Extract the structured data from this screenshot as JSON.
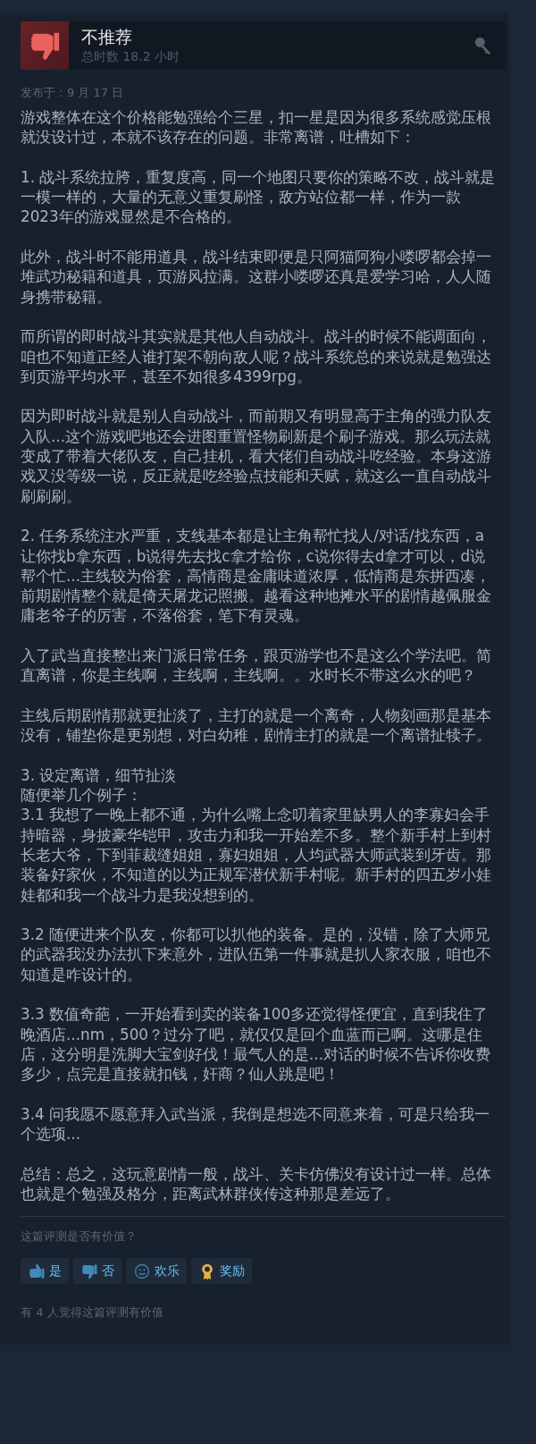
{
  "review": {
    "recommended": false,
    "verdict": "不推荐",
    "hours": "总时数 18.2 小时",
    "posted": "发布于：9 月 17 日"
  },
  "paragraphs": [
    [
      "游戏整体在这个价格能勉强给个三星，扣一星是因为很多系统感觉压根就没设计过，本就不该存在的问题。非常离谱，吐槽如下："
    ],
    [
      "1. 战斗系统拉胯，重复度高，同一个地图只要你的策略不改，战斗就是一模一样的，大量的无意义重复刷怪，敌方站位都一样，作为一款2023年的游戏显然是不合格的。"
    ],
    [
      "此外，战斗时不能用道具，战斗结束即便是只阿猫阿狗小喽啰都会掉一堆武功秘籍和道具，页游风拉满。这群小喽啰还真是爱学习哈，人人随身携带秘籍。"
    ],
    [
      "而所谓的即时战斗其实就是其他人自动战斗。战斗的时候不能调面向，咱也不知道正经人谁打架不朝向敌人呢？战斗系统总的来说就是勉强达到页游平均水平，甚至不如很多4399rpg。"
    ],
    [
      "因为即时战斗就是别人自动战斗，而前期又有明显高于主角的强力队友入队...这个游戏吧地还会进图重置怪物刷新是个刷子游戏。那么玩法就变成了带着大佬队友，自己挂机，看大佬们自动战斗吃经验。本身这游戏又没等级一说，反正就是吃经验点技能和天赋，就这么一直自动战斗刷刷刷。"
    ],
    [
      "2. 任务系统注水严重，支线基本都是让主角帮忙找人/对话/找东西，a让你找b拿东西，b说得先去找c拿才给你，c说你得去d拿才可以，d说帮个忙...主线较为俗套，高情商是金庸味道浓厚，低情商是东拼西凑，前期剧情整个就是倚天屠龙记照搬。越看这种地摊水平的剧情越佩服金庸老爷子的厉害，不落俗套，笔下有灵魂。"
    ],
    [
      "入了武当直接整出来门派日常任务，跟页游学也不是这么个学法吧。简直离谱，你是主线啊，主线啊，主线啊。。水时长不带这么水的吧？"
    ],
    [
      "主线后期剧情那就更扯淡了，主打的就是一个离奇，人物刻画那是基本没有，铺垫你是更别想，对白幼稚，剧情主打的就是一个离谱扯犊子。"
    ],
    [
      "3. 设定离谱，细节扯淡",
      "随便举几个例子：",
      "3.1 我想了一晚上都不通，为什么嘴上念叨着家里缺男人的李寡妇会手持暗器，身披豪华铠甲，攻击力和我一开始差不多。整个新手村上到村长老大爷，下到菲裁缝姐姐，寡妇姐姐，人均武器大师武装到牙齿。那装备好家伙，不知道的以为正规军潜伏新手村呢。新手村的四五岁小娃娃都和我一个战斗力是我没想到的。"
    ],
    [
      "3.2 随便进来个队友，你都可以扒他的装备。是的，没错，除了大师兄的武器我没办法扒下来意外，进队伍第一件事就是扒人家衣服，咱也不知道是咋设计的。"
    ],
    [
      "3.3 数值奇葩，一开始看到卖的装备100多还觉得怪便宜，直到我住了晚酒店...nm，500？过分了吧，就仅仅是回个血蓝而已啊。这哪是住店，这分明是洗脚大宝剑好伐！最气人的是...对话的时候不告诉你收费多少，点完是直接就扣钱，奸商？仙人跳是吧！"
    ],
    [
      "3.4 问我愿不愿意拜入武当派，我倒是想选不同意来着，可是只给我一个选项..."
    ],
    [
      "总结：总之，这玩意剧情一般，战斗、关卡仿佛没有设计过一样。总体也就是个勉强及格分，距离武林群侠传这种那是差远了。"
    ]
  ],
  "helpful_prompt": "这篇评测是否有价值？",
  "buttons": [
    {
      "kind": "yes",
      "label": "是"
    },
    {
      "kind": "no",
      "label": "否"
    },
    {
      "kind": "funny",
      "label": "欢乐"
    },
    {
      "kind": "award",
      "label": "奖励"
    }
  ],
  "helpful_count": "有 4 人觉得这篇评测有价值"
}
